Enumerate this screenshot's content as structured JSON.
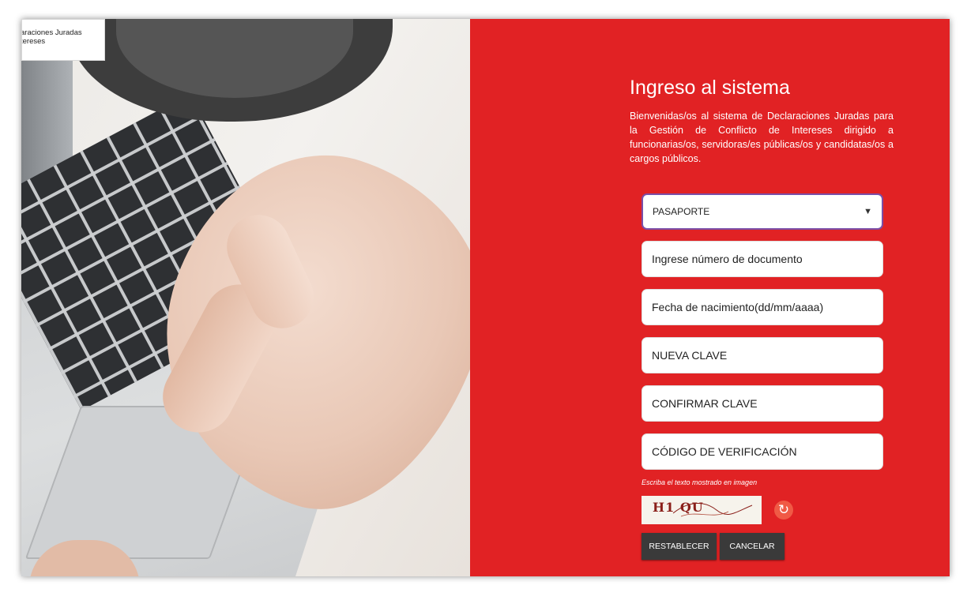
{
  "branding": {
    "line1": "araciones Juradas",
    "line2": "tereses"
  },
  "login": {
    "title": "Ingreso al sistema",
    "intro": "Bienvenidas/os al sistema de Declaraciones Juradas para la Gestión de Conflicto de Intereses dirigido a funcionarias/os, servidoras/es públicas/os y candidatas/os a cargos públicos.",
    "document_type": {
      "selected": "PASAPORTE",
      "caret_icon": "chevron-down-icon"
    },
    "fields": {
      "document_number_placeholder": "Ingrese número de documento",
      "birth_date_placeholder": "Fecha de nacimiento(dd/mm/aaaa)",
      "new_password_placeholder": "NUEVA CLAVE",
      "confirm_password_placeholder": "CONFIRMAR CLAVE",
      "verification_code_placeholder": "CÓDIGO DE VERIFICACIÓN"
    },
    "captcha": {
      "hint": "Escriba el texto mostrado en imagen",
      "text": "H1 QU",
      "refresh_icon": "refresh-icon"
    },
    "buttons": {
      "reset": "RESTABLECER",
      "cancel": "CANCELAR"
    }
  },
  "colors": {
    "panel": "#e12224",
    "button": "#3a3a3a",
    "select_border": "#7a4fa8",
    "refresh": "#f05a45"
  }
}
